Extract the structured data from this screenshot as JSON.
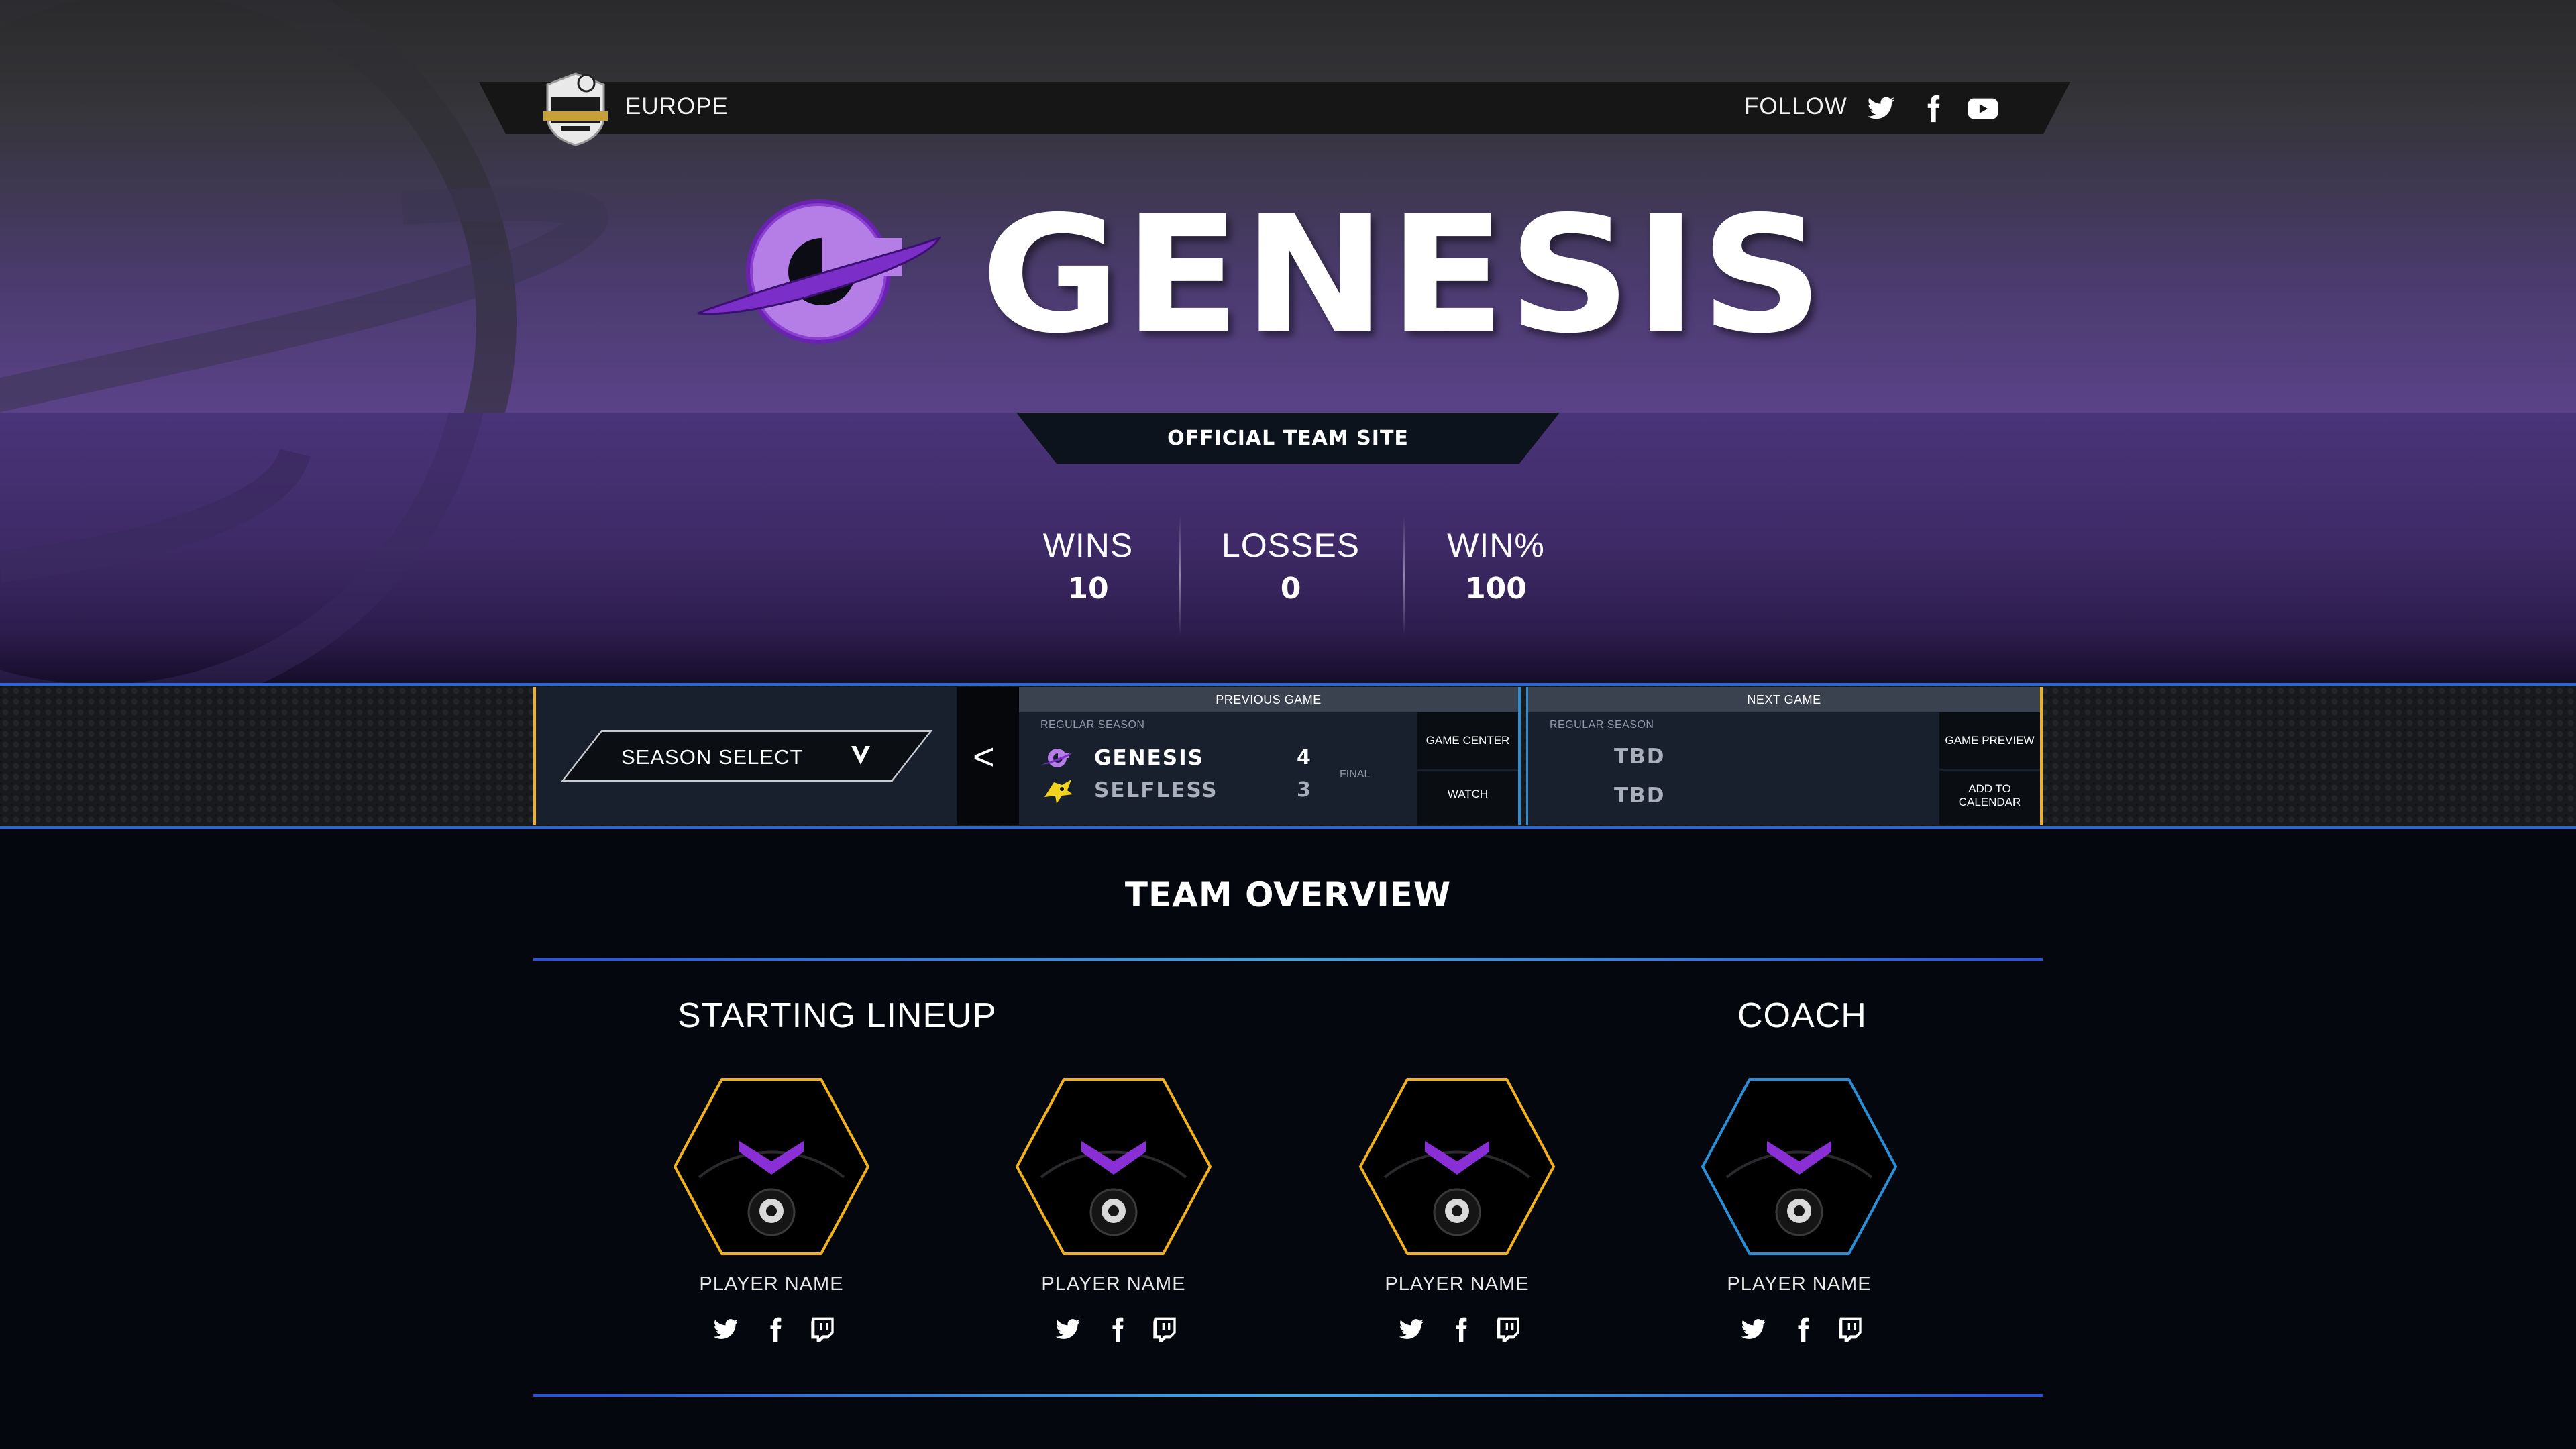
{
  "header": {
    "region": "EUROPE",
    "follow_label": "FOLLOW",
    "social_icons": [
      "twitter-icon",
      "facebook-icon",
      "youtube-icon"
    ]
  },
  "team": {
    "name": "GENESIS",
    "site_label": "OFFICIAL TEAM SITE",
    "colors": {
      "primary": "#8a3fd1",
      "accent": "#f1b11c",
      "line": "#2a66d6"
    }
  },
  "stats": [
    {
      "label": "WINS",
      "value": "10"
    },
    {
      "label": "LOSSES",
      "value": "0"
    },
    {
      "label": "WIN%",
      "value": "100"
    }
  ],
  "schedule": {
    "season_select": "SEASON SELECT",
    "prev_arrow": "<",
    "previous_game": {
      "header": "PREVIOUS GAME",
      "stage": "REGULAR SEASON",
      "home": {
        "name": "GENESIS",
        "score": "4"
      },
      "away": {
        "name": "SELFLESS",
        "score": "3"
      },
      "status": "FINAL",
      "buttons": [
        "GAME CENTER",
        "WATCH"
      ]
    },
    "next_game": {
      "header": "NEXT GAME",
      "stage": "REGULAR SEASON",
      "home": {
        "name": "TBD"
      },
      "away": {
        "name": "TBD"
      },
      "buttons": [
        "GAME PREVIEW",
        "ADD TO CALENDAR"
      ]
    }
  },
  "overview": {
    "title": "TEAM OVERVIEW",
    "lineup_label": "STARTING LINEUP",
    "coach_label": "COACH",
    "players": [
      {
        "name": "PLAYER NAME",
        "role": "starter"
      },
      {
        "name": "PLAYER NAME",
        "role": "starter"
      },
      {
        "name": "PLAYER NAME",
        "role": "starter"
      },
      {
        "name": "PLAYER NAME",
        "role": "coach"
      }
    ]
  }
}
